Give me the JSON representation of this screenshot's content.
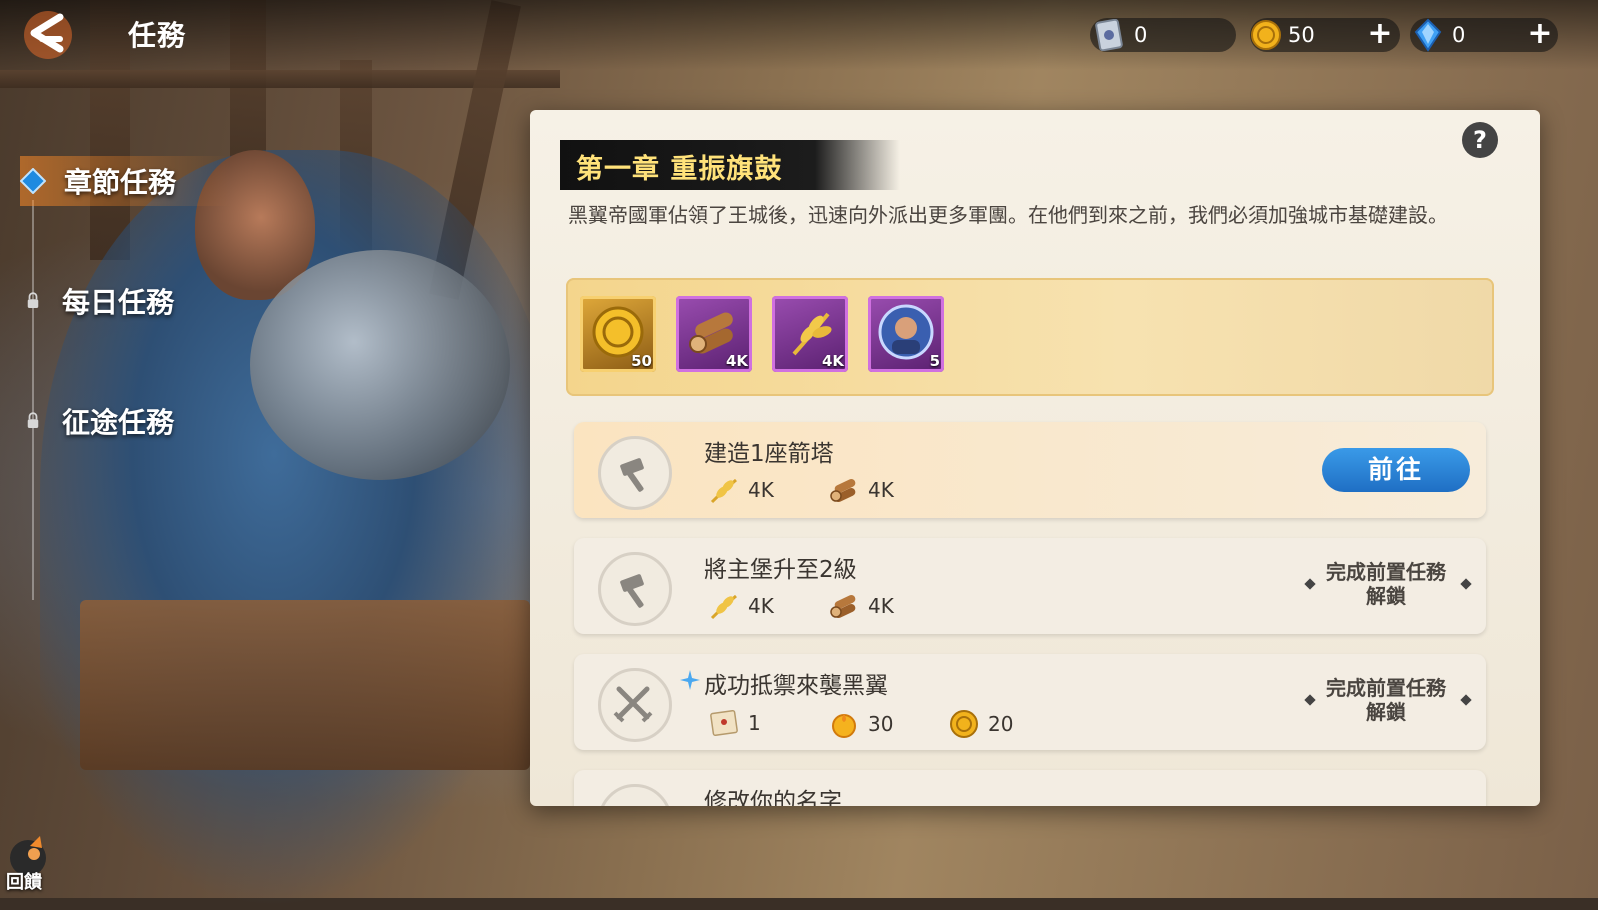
{
  "header": {
    "title": "任務",
    "resources": [
      {
        "name": "ticket",
        "icon": "ticket-icon",
        "value": "0"
      },
      {
        "name": "gold",
        "icon": "gold-coin-icon",
        "value": "50"
      },
      {
        "name": "gem",
        "icon": "blue-gem-icon",
        "value": "0"
      }
    ]
  },
  "nav": {
    "items": [
      {
        "label": "章節任務",
        "active": true,
        "locked": false
      },
      {
        "label": "每日任務",
        "active": false,
        "locked": true
      },
      {
        "label": "征途任務",
        "active": false,
        "locked": true
      }
    ]
  },
  "chapter": {
    "title": "第一章 重振旗鼓",
    "description": "黑翼帝國軍佔領了王城後，迅速向外派出更多軍團。在他們到來之前，我們必須加強城市基礎建設。",
    "rewards": [
      {
        "icon": "gold-coin-icon",
        "qty": "50",
        "rarity": "gold"
      },
      {
        "icon": "wood-logs-icon",
        "qty": "4K",
        "rarity": "purple"
      },
      {
        "icon": "wheat-icon",
        "qty": "4K",
        "rarity": "purple"
      },
      {
        "icon": "hero-portrait-icon",
        "qty": "5",
        "rarity": "purple"
      }
    ]
  },
  "tasks": [
    {
      "name": "建造1座箭塔",
      "icon": "hammer-icon",
      "costs": [
        {
          "icon": "wheat-icon",
          "value": "4K"
        },
        {
          "icon": "wood-logs-icon",
          "value": "4K"
        }
      ],
      "action": "前往"
    },
    {
      "name": "將主堡升至2級",
      "icon": "hammer-icon",
      "costs": [
        {
          "icon": "wheat-icon",
          "value": "4K"
        },
        {
          "icon": "wood-logs-icon",
          "value": "4K"
        }
      ],
      "locked_text": "完成前置任務解鎖"
    },
    {
      "name": "成功抵禦來襲黑翼",
      "icon": "crossed-swords-icon",
      "costs": [
        {
          "icon": "scroll-letter-icon",
          "value": "1"
        },
        {
          "icon": "fire-orb-icon",
          "value": "30"
        },
        {
          "icon": "gold-coin-icon",
          "value": "20"
        }
      ],
      "locked_text": "完成前置任務解鎖"
    },
    {
      "name": "修改你的名字"
    }
  ],
  "feedback": {
    "label": "回饋"
  },
  "colors": {
    "accent_blue": "#2a82d6",
    "banner_text": "#ffe27a",
    "active_nav": "#ff8c28"
  }
}
